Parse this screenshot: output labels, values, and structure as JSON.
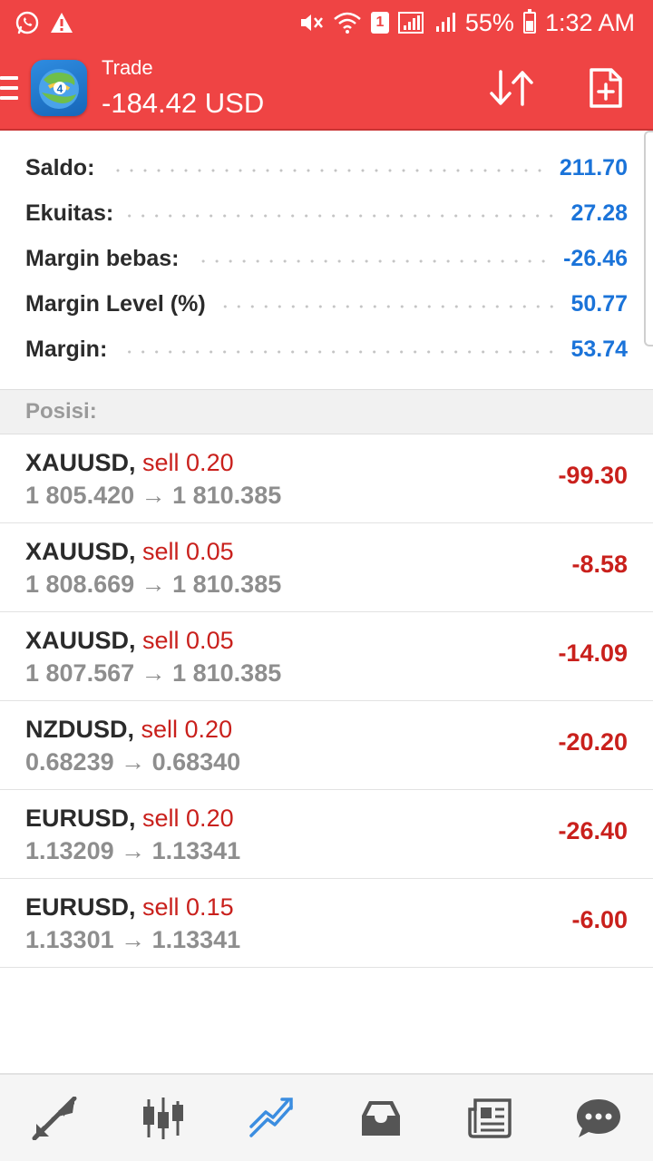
{
  "status_bar": {
    "battery": "55%",
    "time": "1:32 AM",
    "sim_slot": "1"
  },
  "header": {
    "title": "Trade",
    "subtitle": "-184.42 USD"
  },
  "summary": {
    "rows": [
      {
        "label": "Saldo:",
        "value": "211.70"
      },
      {
        "label": "Ekuitas:",
        "value": "27.28"
      },
      {
        "label": "Margin bebas:",
        "value": "-26.46"
      },
      {
        "label": "Margin Level (%)",
        "value": "50.77"
      },
      {
        "label": "Margin:",
        "value": "53.74"
      }
    ]
  },
  "positions": {
    "title": "Posisi:",
    "items": [
      {
        "symbol": "XAUUSD,",
        "type": "sell 0.20",
        "prices": "1 805.420 → 1 810.385",
        "profit": "-99.30"
      },
      {
        "symbol": "XAUUSD,",
        "type": "sell 0.05",
        "prices": "1 808.669 → 1 810.385",
        "profit": "-8.58"
      },
      {
        "symbol": "XAUUSD,",
        "type": "sell 0.05",
        "prices": "1 807.567 → 1 810.385",
        "profit": "-14.09"
      },
      {
        "symbol": "NZDUSD,",
        "type": "sell 0.20",
        "prices": "0.68239 → 0.68340",
        "profit": "-20.20"
      },
      {
        "symbol": "EURUSD,",
        "type": "sell 0.20",
        "prices": "1.13209 → 1.13341",
        "profit": "-26.40"
      },
      {
        "symbol": "EURUSD,",
        "type": "sell 0.15",
        "prices": "1.13301 → 1.13341",
        "profit": "-6.00"
      }
    ]
  },
  "bottom_nav": {
    "items": [
      {
        "icon": "quotes-arrows-icon",
        "active": false
      },
      {
        "icon": "candlestick-chart-icon",
        "active": false
      },
      {
        "icon": "trade-trend-icon",
        "active": true
      },
      {
        "icon": "history-inbox-icon",
        "active": false
      },
      {
        "icon": "news-icon",
        "active": false
      },
      {
        "icon": "messages-chat-icon",
        "active": false
      }
    ]
  },
  "colors": {
    "brand_red": "#ef4444",
    "value_blue": "#1a73d9",
    "loss_red": "#c9201c",
    "active_nav": "#3b8de0",
    "inactive_nav": "#555555"
  }
}
